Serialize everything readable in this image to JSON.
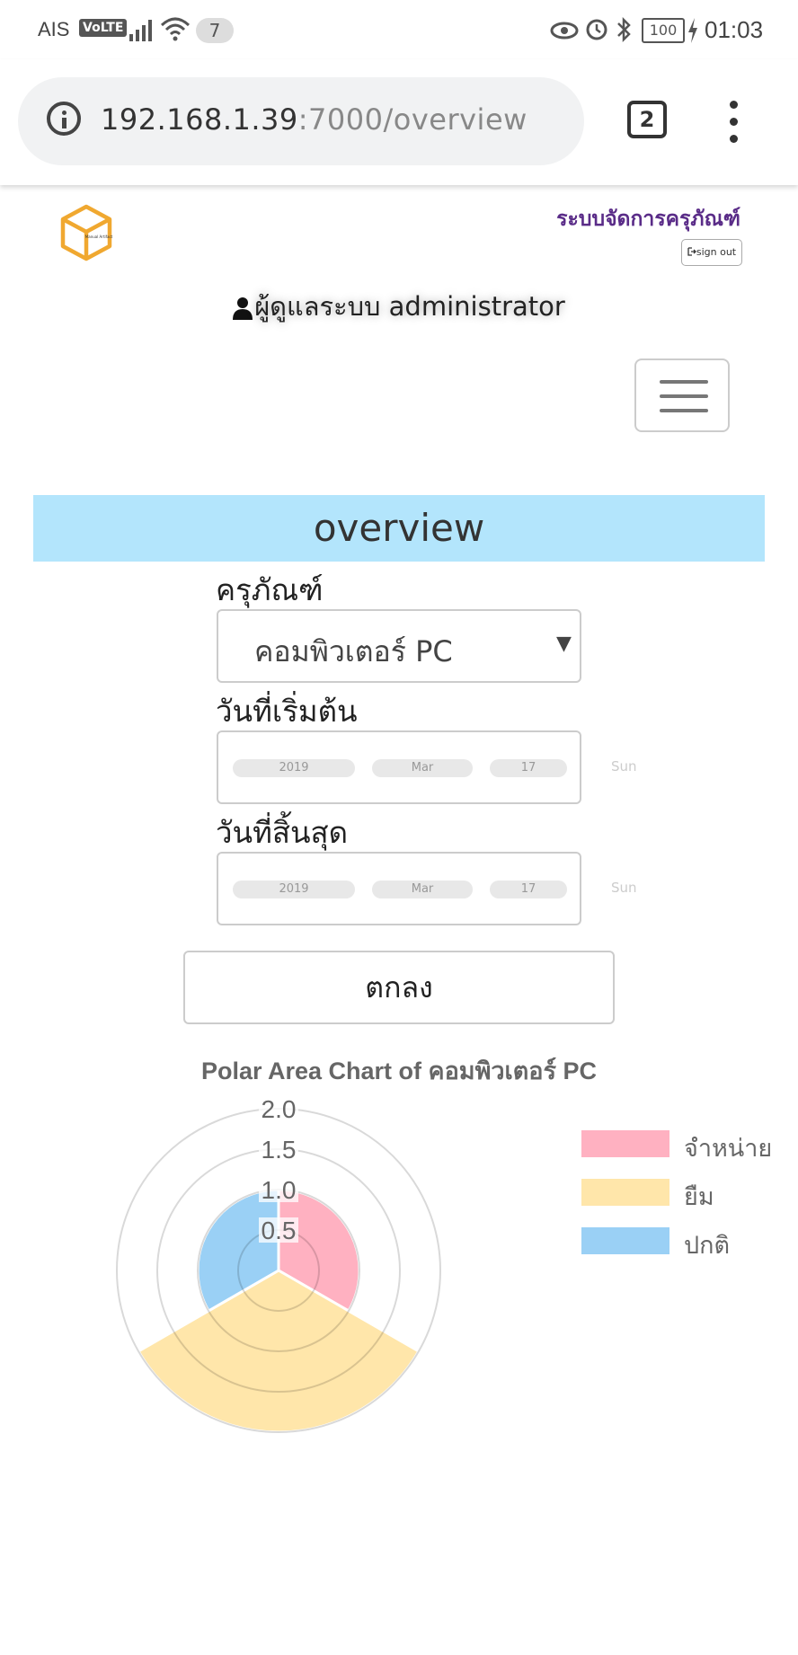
{
  "status_bar": {
    "carrier": "AIS",
    "volte": "VoLTE",
    "notification_count": "7",
    "battery": "100",
    "time": "01:03"
  },
  "browser": {
    "url_host": "192.168.1.39",
    "url_rest": ":7000/overview",
    "tab_count": "2"
  },
  "header": {
    "logo_text": "Manual Artifact",
    "system_title": "ระบบจัดการครุภัณฑ์",
    "signout_label": "sign out",
    "admin_label": "ผู้ดูแลระบบ administrator"
  },
  "page": {
    "title": "overview"
  },
  "form": {
    "equipment_label": "ครุภัณฑ์",
    "equipment_value": "คอมพิวเตอร์ PC",
    "start_label": "วันที่เริ่มต้น",
    "start_date": {
      "year": "2019",
      "month": "Mar",
      "day": "17",
      "weekday": "Sun"
    },
    "end_label": "วันที่สิ้นสุด",
    "end_date": {
      "year": "2019",
      "month": "Mar",
      "day": "17",
      "weekday": "Sun"
    },
    "submit_label": "ตกลง"
  },
  "chart_data": {
    "type": "polarArea",
    "title": "Polar Area Chart of คอมพิวเตอร์ PC",
    "r_ticks": [
      "0.5",
      "1.0",
      "1.5",
      "2.0"
    ],
    "r_max": 2.0,
    "categories": [
      "จำหน่าย",
      "ยืม",
      "ปกติ"
    ],
    "values": [
      1,
      2,
      1
    ],
    "colors": [
      "#ffb1c1",
      "#ffe6aa",
      "#9ad0f5"
    ],
    "legend_position": "right"
  }
}
